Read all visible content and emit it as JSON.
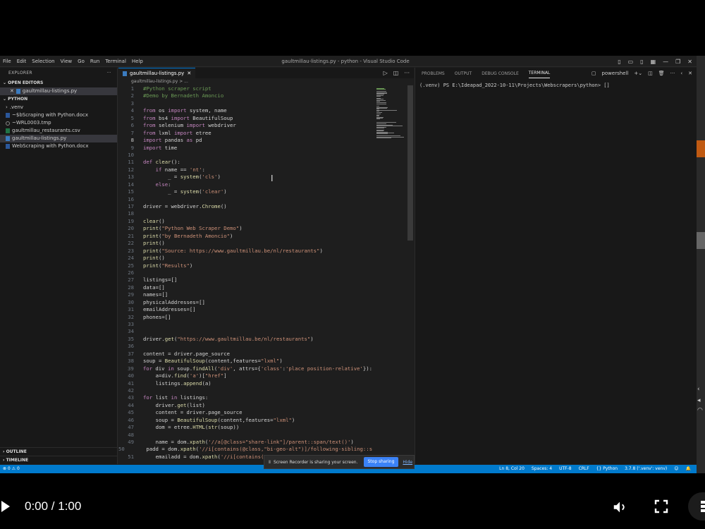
{
  "window": {
    "menu": [
      "File",
      "Edit",
      "Selection",
      "View",
      "Go",
      "Run",
      "Terminal",
      "Help"
    ],
    "title": "gaultmillau-listings.py - python - Visual Studio Code"
  },
  "explorer": {
    "header": "EXPLORER",
    "open_editors_label": "OPEN EDITORS",
    "open_editors": [
      {
        "name": "gaultmillau-listings.py",
        "icon": "python-file-icon"
      }
    ],
    "folder_label": "PYTHON",
    "files": [
      {
        "name": ".venv",
        "icon": "chevron-right-icon"
      },
      {
        "name": "~$bScraping with Python.docx",
        "icon": "word-file-icon"
      },
      {
        "name": "~WRL0003.tmp",
        "icon": "temp-file-icon"
      },
      {
        "name": "gaultmillau_restaurants.csv",
        "icon": "csv-file-icon"
      },
      {
        "name": "gaultmillau-listings.py",
        "icon": "python-file-icon",
        "selected": true
      },
      {
        "name": "WebScraping with Python.docx",
        "icon": "word-file-icon"
      }
    ],
    "outline_label": "OUTLINE",
    "timeline_label": "TIMELINE"
  },
  "editor": {
    "tab_label": "gaultmillau-listings.py",
    "breadcrumb": "gaultmillau-listings.py > ...",
    "current_line": 8,
    "lines": [
      "#Python scraper script",
      "#Demo by Bernadeth Amoncio",
      "",
      "from os import system, name",
      "from bs4 import BeautifulSoup",
      "from selenium import webdriver",
      "from lxml import etree",
      "import pandas as pd",
      "import time",
      "",
      "def clear():",
      "    if name == 'nt':",
      "        _ = system('cls')",
      "    else:",
      "        _ = system('clear')",
      "",
      "driver = webdriver.Chrome()",
      "",
      "clear()",
      "print(\"Python Web Scraper Demo\")",
      "print(\"by Bernadeth Amoncio\")",
      "print()",
      "print(\"Source: https://www.gaultmillau.be/nl/restaurants\")",
      "print()",
      "print(\"Results\")",
      "",
      "listings=[]",
      "data=[]",
      "names=[]",
      "physicalAddresses=[]",
      "emailAddresses=[]",
      "phones=[]",
      "",
      "",
      "driver.get(\"https://www.gaultmillau.be/nl/restaurants\")",
      "",
      "content = driver.page_source",
      "soup = BeautifulSoup(content,features=\"lxml\")",
      "for div in soup.findAll('div', attrs={'class':'place position-relative'}):",
      "    a=div.find('a')[\"href\"]",
      "    listings.append(a)",
      "",
      "for list in listings:",
      "    driver.get(list)",
      "    content = driver.page_source",
      "    soup = BeautifulSoup(content,features=\"lxml\")",
      "    dom = etree.HTML(str(soup))",
      "",
      "    name = dom.xpath('//a[@class=\"share-link\"]/parent::span/text()')",
      "    padd = dom.xpath('//i[contains(@class,\"bi-geo-alt\")]/following-sibling::s",
      "    emailadd = dom.xpath('//i[contains(@c"
    ]
  },
  "panel": {
    "tabs": [
      "PROBLEMS",
      "OUTPUT",
      "DEBUG CONSOLE",
      "TERMINAL"
    ],
    "active_tab": "TERMINAL",
    "shell_label": "powershell",
    "terminal_text": "(.venv) PS E:\\Ideapad_2022-10-11\\Projects\\Webscrapers\\python> []"
  },
  "statusbar": {
    "left": "⊗ 0 ⚠ 0",
    "items": [
      "Ln 8, Col 20",
      "Spaces: 4",
      "UTF-8",
      "CRLF",
      "{} Python",
      "3.7.8 ('.venv': venv)"
    ]
  },
  "share_bar": {
    "message": "Screen Recorder is sharing your screen.",
    "stop_label": "Stop sharing",
    "hide_label": "Hide"
  },
  "video": {
    "time": "0:00 / 1:00",
    "progress": 0
  },
  "colors": {
    "keyword": "#c586c0",
    "function": "#dcdcaa",
    "string": "#ce9178",
    "comment": "#6a9955",
    "variable": "#9cdcfe",
    "module": "#4ec9b0",
    "statusbar": "#007acc"
  }
}
